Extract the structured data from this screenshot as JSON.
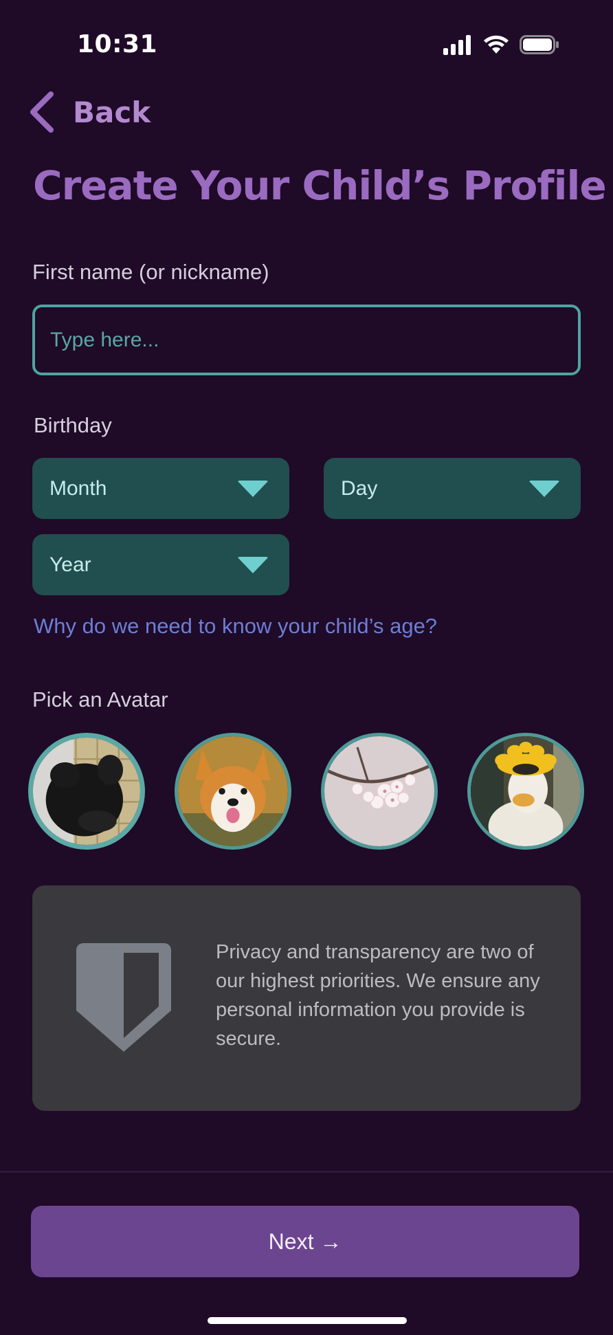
{
  "status_bar": {
    "time": "10:31",
    "icons": [
      "signal-icon",
      "wifi-icon",
      "battery-icon"
    ]
  },
  "nav": {
    "back_label": "Back",
    "back_icon": "chevron-left-icon"
  },
  "page": {
    "title": "Create Your Child’s Profile"
  },
  "form": {
    "name_label": "First name (or nickname)",
    "name_placeholder": "Type here...",
    "name_value": "",
    "birthday_label": "Birthday",
    "month_label": "Month",
    "day_label": "Day",
    "year_label": "Year",
    "why_link": "Why do we need to know your child’s age?",
    "avatar_label": "Pick an Avatar",
    "avatars": [
      {
        "name": "black-cat",
        "selected": true
      },
      {
        "name": "corgi-dog",
        "selected": false
      },
      {
        "name": "cherry-blossom",
        "selected": false
      },
      {
        "name": "duck-with-flower-hat",
        "selected": false
      }
    ]
  },
  "privacy": {
    "icon": "shield-icon",
    "text": "Privacy and transparency are two of our highest priorities. We ensure any personal information you provide is secure."
  },
  "footer": {
    "next_label": "Next →"
  },
  "colors": {
    "background": "#1f0a28",
    "title": "#9a6bc0",
    "accent_teal": "#4ea4a2",
    "dropdown_bg": "#214e4e",
    "link": "#6b7fd6",
    "card_bg": "#3a393d",
    "button": "#6c4590"
  }
}
